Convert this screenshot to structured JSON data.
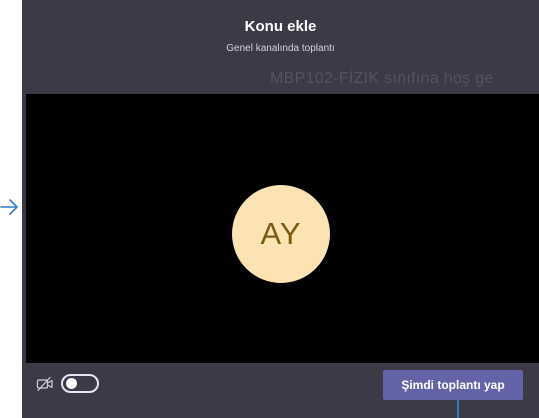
{
  "dialog": {
    "title": "Konu ekle",
    "subtitle": "Genel kanalında toplantı",
    "background_text": "MBP102-FİZİK sınıfına hoş ge"
  },
  "preview": {
    "avatar_initials": "AY",
    "avatar_color": "#fbe3b4"
  },
  "controls": {
    "camera_icon": "camera-off-icon",
    "camera_toggle_on": false,
    "join_button_label": "Şimdi toplantı yap",
    "accent_color": "#6264a7"
  },
  "annotation": {
    "arrow_icon": "arrow-right-icon",
    "arrow_color": "#2f7fc4"
  }
}
